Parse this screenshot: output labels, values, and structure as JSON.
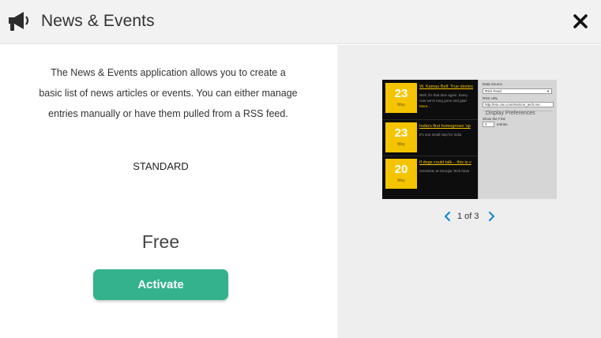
{
  "header": {
    "title": "News & Events",
    "icon": "megaphone-icon",
    "close_icon": "close-icon"
  },
  "main": {
    "description": "The News & Events application allows you to create a basic list of news articles or events. You can either manage entries manually or have them pulled from a RSS feed.",
    "tier": "STANDARD",
    "price": "Free",
    "activate_label": "Activate",
    "accent": "#34b28e"
  },
  "preview": {
    "items": [
      {
        "day": "23",
        "month": "May",
        "title": "W. Kamau Bell: True stories",
        "body": "Well, it's that time again. Every",
        "body2": "now we're long gone and glad",
        "more": "More..."
      },
      {
        "day": "23",
        "month": "May",
        "title": "India's first homegrown 'sp",
        "body": "It's one small step for India",
        "body2": "",
        "more": ""
      },
      {
        "day": "20",
        "month": "May",
        "title": "If dogs could talk... this is v",
        "body": "Scientists at Georgia Tech have",
        "body2": "",
        "more": ""
      }
    ],
    "panel": {
      "data_source_label": "Data Source",
      "data_source_value": "RSS Feed",
      "rss_url_label": "RSS URL",
      "rss_url_value": "http://rss.cnn.com/rss/cnn_tech.rss",
      "display_heading": "Display Preferences",
      "show_first_label": "Show the First",
      "show_first_value": "3",
      "entries_label": "entries"
    },
    "pager": {
      "current": "1 of 3",
      "prev_icon": "chevron-left-icon",
      "next_icon": "chevron-right-icon"
    },
    "yellow": "#f5c400"
  }
}
